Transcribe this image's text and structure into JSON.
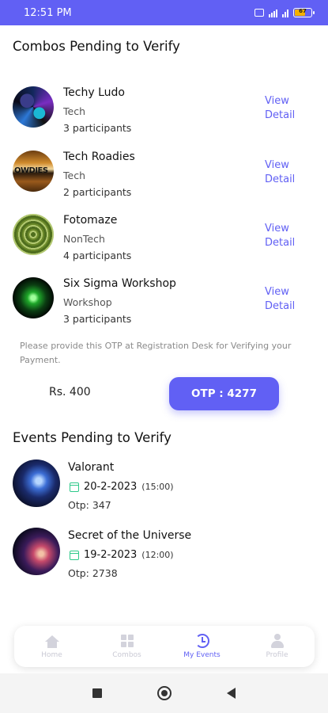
{
  "status_bar": {
    "time": "12:51 PM",
    "battery": "67",
    "signal": "4G"
  },
  "combos_section": {
    "title": "Combos Pending to Verify",
    "view_label": "View Detail",
    "items": [
      {
        "name": "Techy Ludo",
        "category": "Tech",
        "participants": "3 participants"
      },
      {
        "name": "Tech Roadies",
        "category": "Tech",
        "participants": "2 participants",
        "avatar_text": "OWDIES"
      },
      {
        "name": "Fotomaze",
        "category": "NonTech",
        "participants": "4 participants"
      },
      {
        "name": "Six Sigma Workshop",
        "category": "Workshop",
        "participants": "3 participants"
      }
    ],
    "otp_note": "Please provide this OTP at Registration Desk for Verifying your Payment.",
    "amount": "Rs. 400",
    "otp_button": "OTP : 4277"
  },
  "events_section": {
    "title": "Events Pending to Verify",
    "items": [
      {
        "name": "Valorant",
        "date": "20-2-2023",
        "time": "(15:00)",
        "otp": "Otp: 347"
      },
      {
        "name": "Secret of the Universe",
        "date": "19-2-2023",
        "time": "(12:00)",
        "otp": "Otp: 2738"
      }
    ]
  },
  "bottom_nav": {
    "items": [
      {
        "label": "Home",
        "icon": "home-icon"
      },
      {
        "label": "Combos",
        "icon": "grid-icon"
      },
      {
        "label": "My Events",
        "icon": "history-icon",
        "active": true
      },
      {
        "label": "Profile",
        "icon": "person-icon"
      }
    ]
  },
  "colors": {
    "accent": "#6160f4",
    "calendar": "#2ec98a"
  }
}
